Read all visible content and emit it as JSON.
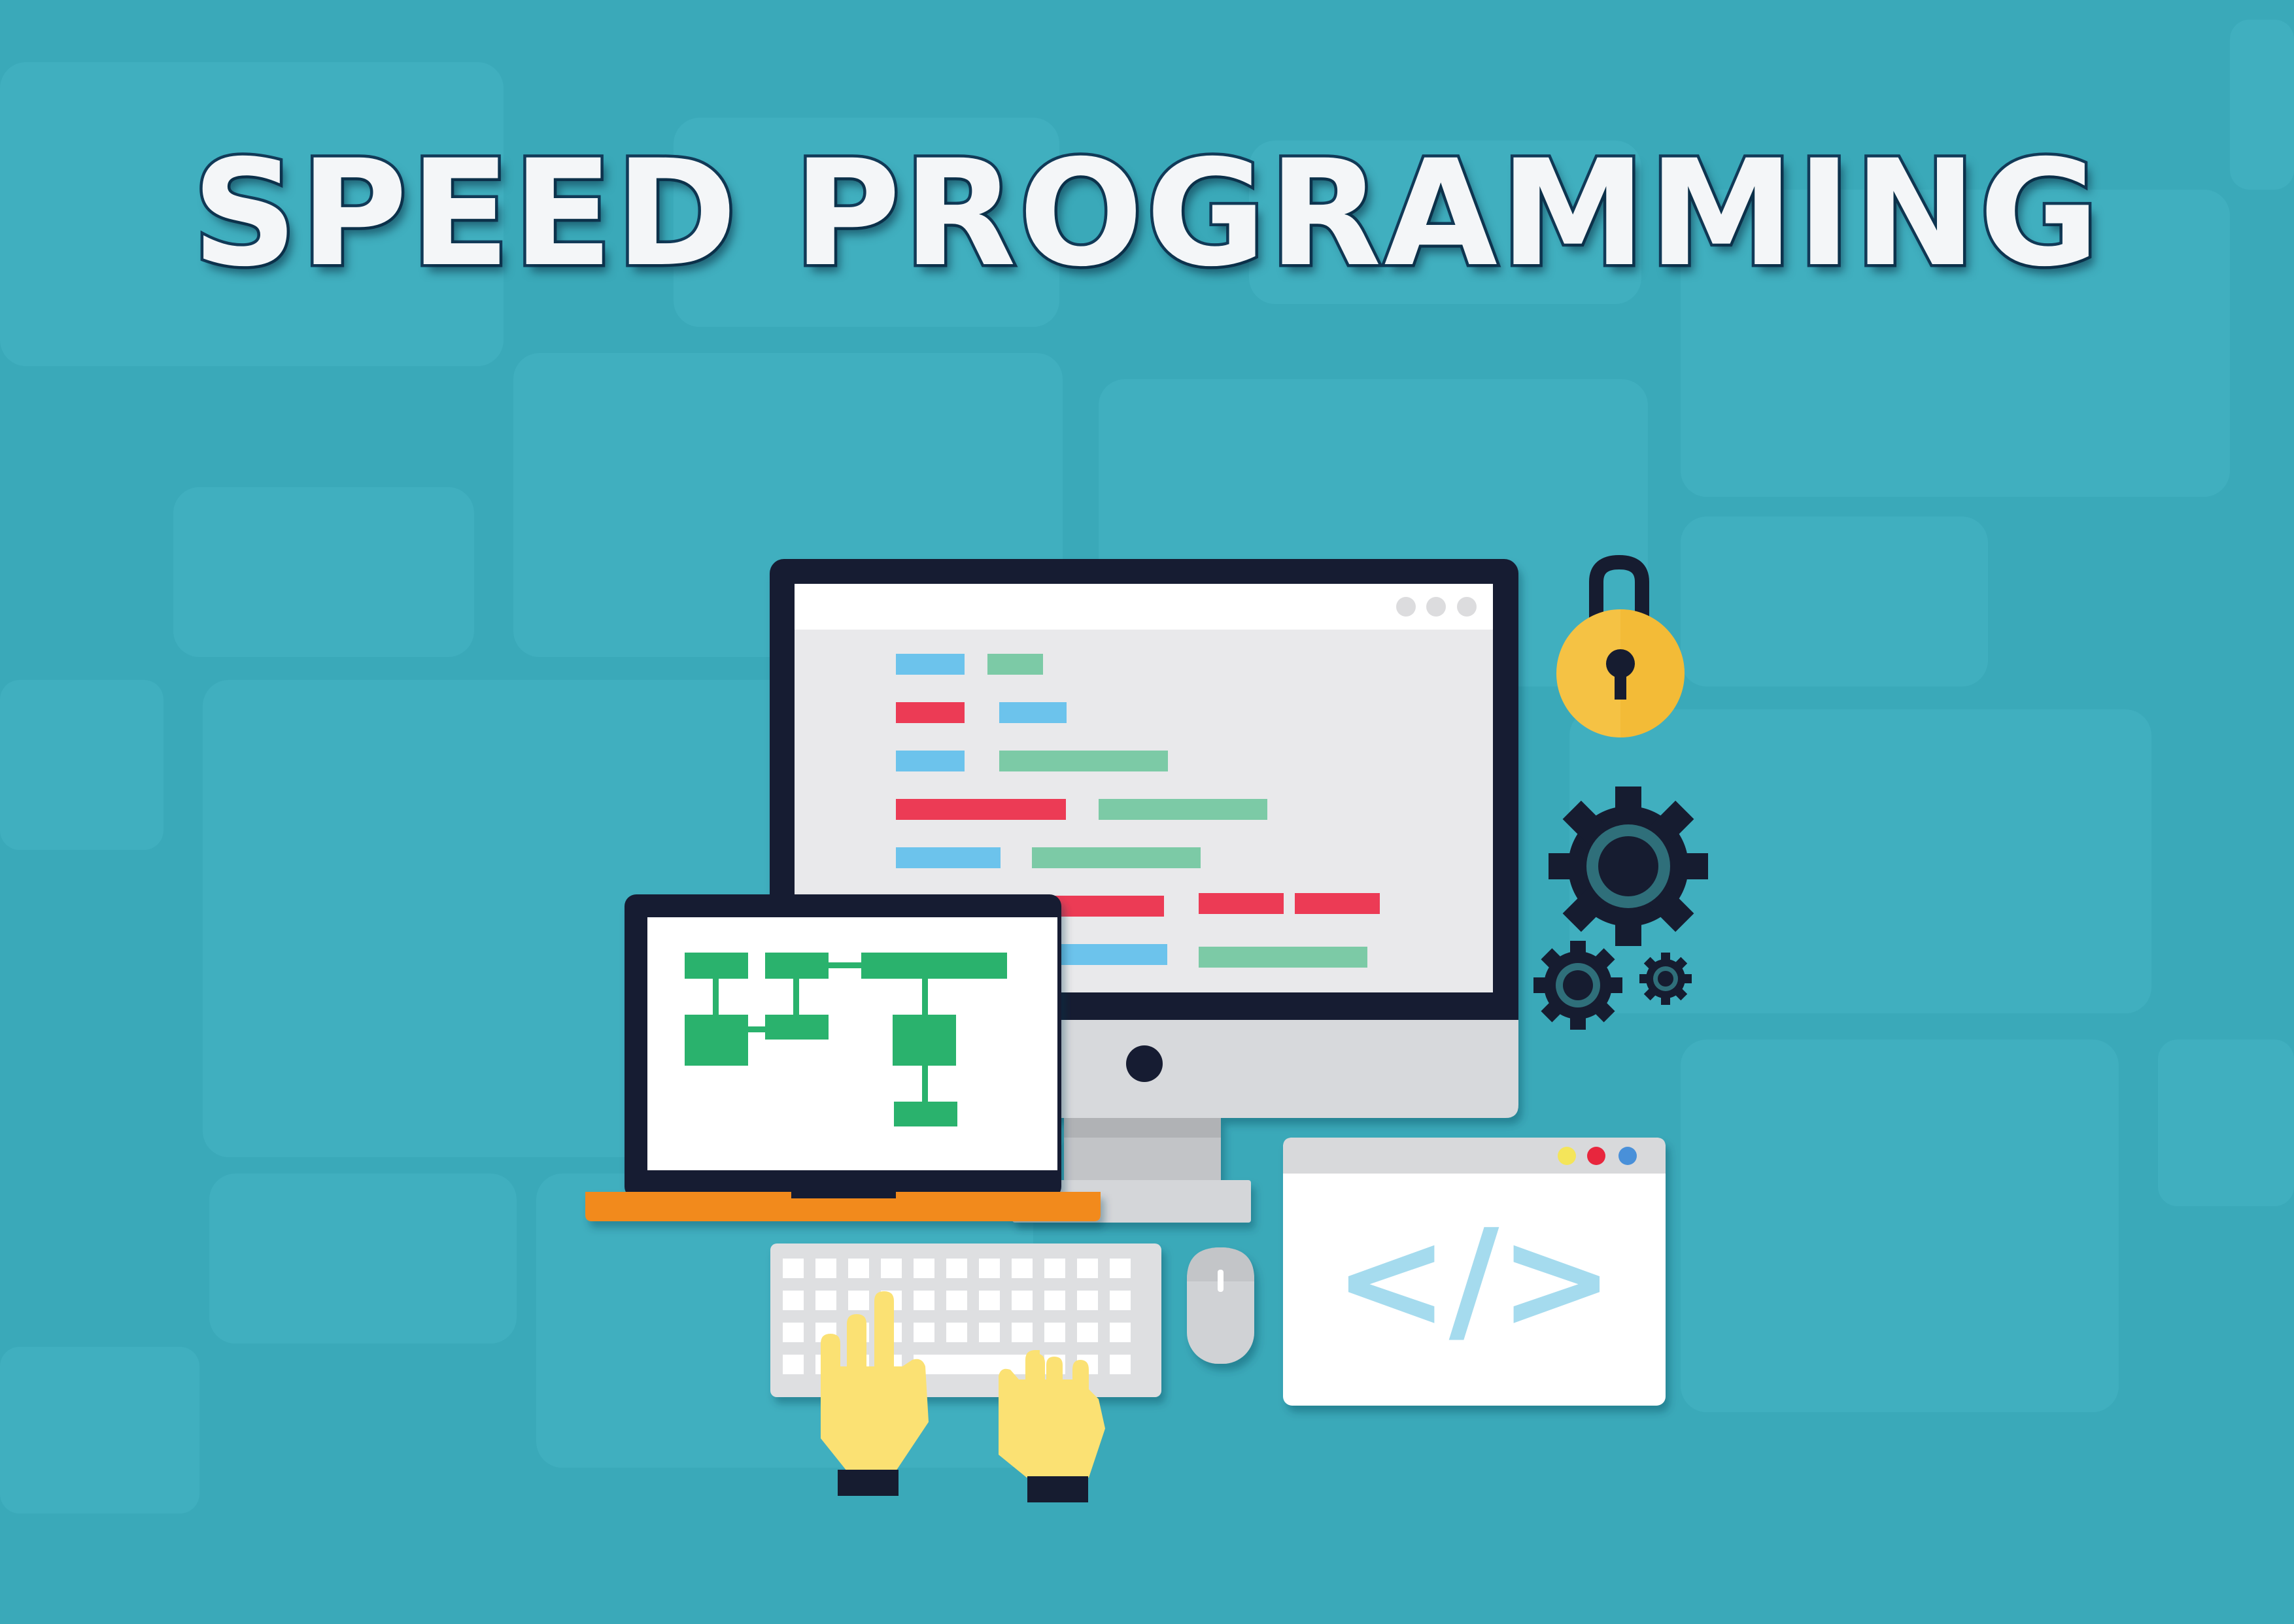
{
  "title": "SPEED PROGRAMMING",
  "code_tag": "</>",
  "illustration": {
    "items": [
      {
        "name": "desktop-monitor",
        "shows": "colored code lines"
      },
      {
        "name": "laptop",
        "shows": "green flowchart"
      },
      {
        "name": "padlock-icon"
      },
      {
        "name": "gear-icons",
        "count": 3
      },
      {
        "name": "keyboard"
      },
      {
        "name": "mouse"
      },
      {
        "name": "hands",
        "count": 2
      },
      {
        "name": "browser-window",
        "shows": "code tag"
      }
    ]
  },
  "colors": {
    "background": "#3aa9b9",
    "background_tile": "#45b5c4",
    "title_text": "#f4f6f8",
    "title_outline": "#123b59",
    "device_frame": "#161c30",
    "screen_bg": "#e8e8ea",
    "code_blue": "#6cc3ec",
    "code_green": "#7ccaa6",
    "code_red": "#ec3a54",
    "flowchart_green": "#2ab26d",
    "laptop_base": "#f28a1f",
    "lock_gold": "#f5c244",
    "hand_yellow": "#fbe173",
    "dot_yellow": "#f4e55a",
    "dot_red": "#e8263d",
    "dot_blue": "#4a90d9",
    "code_tag": "#a5dbee"
  }
}
